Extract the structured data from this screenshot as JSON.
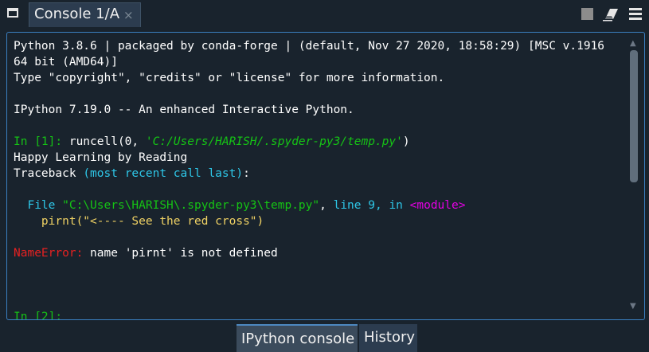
{
  "tab": {
    "title": "Console 1/A",
    "close": "×"
  },
  "console": {
    "banner1a": "Python 3.8.6 | packaged by conda-forge | (default, Nov 27 2020, 18:58:29) [MSC v.1916",
    "banner1b": "64 bit (AMD64)]",
    "banner2": "Type \"copyright\", \"credits\" or \"license\" for more information.",
    "banner3": "IPython 7.19.0 -- An enhanced Interactive Python.",
    "in1_prompt": "In [1]:",
    "in1_cmd": " runcell(0, ",
    "in1_arg": "'C:/Users/HARISH/.spyder-py3/temp.py'",
    "in1_close": ")",
    "out1": "Happy Learning by Reading",
    "tb_label": "Traceback ",
    "tb_paren": "(most recent call last)",
    "tb_colon": ":",
    "file_label": "  File ",
    "file_path": "\"C:\\Users\\HARISH\\.spyder-py3\\temp.py\"",
    "file_comma": ", ",
    "file_line": "line 9",
    "file_in": ", in ",
    "file_module": "<module>",
    "code_line": "    pirnt(\"<---- See the red cross\")",
    "err_type": "NameError:",
    "err_msg": " name 'pirnt' is not defined",
    "in2_prompt": "In [2]:"
  },
  "bottom_tabs": {
    "ipython": "IPython console",
    "history": "History"
  },
  "colors": {
    "prompt": "#15c315",
    "traceback": "#2ec7e8",
    "error": "#e62121",
    "module": "#e400e4",
    "accent": "#3a7fc1"
  }
}
